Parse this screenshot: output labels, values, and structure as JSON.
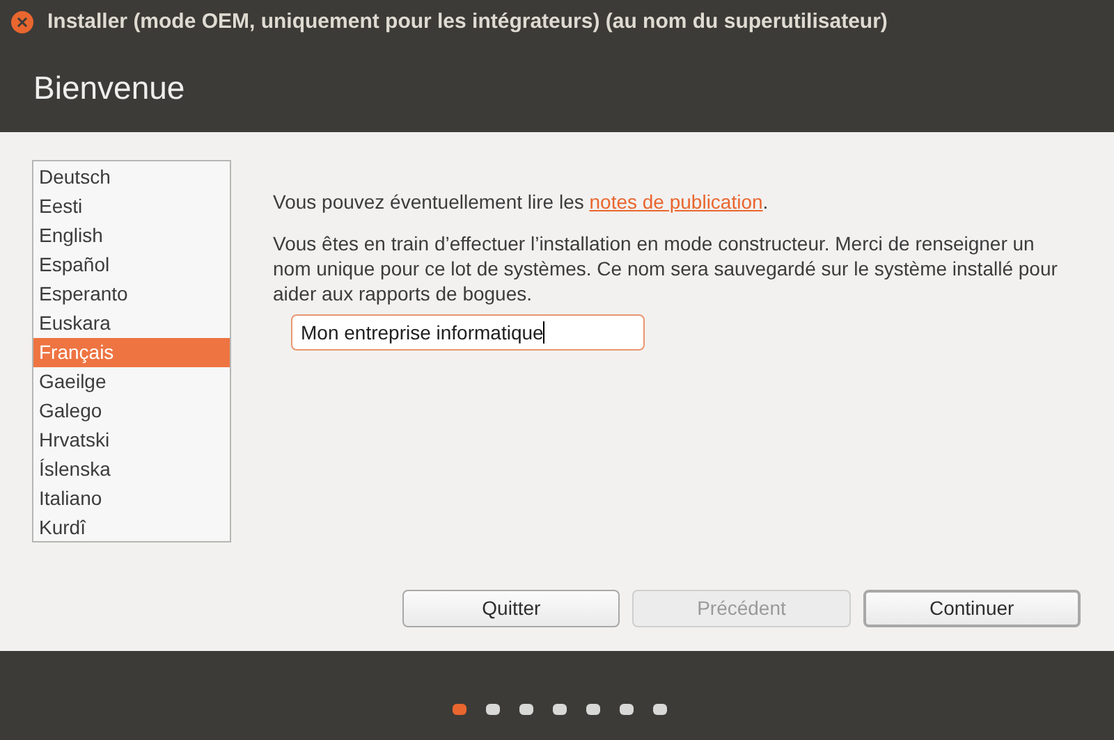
{
  "window": {
    "title": "Installer (mode OEM, uniquement pour les intégrateurs) (au nom du superutilisateur)"
  },
  "header": {
    "title": "Bienvenue"
  },
  "languages": [
    {
      "label": "Deutsch",
      "selected": false
    },
    {
      "label": "Eesti",
      "selected": false
    },
    {
      "label": "English",
      "selected": false
    },
    {
      "label": "Español",
      "selected": false
    },
    {
      "label": "Esperanto",
      "selected": false
    },
    {
      "label": "Euskara",
      "selected": false
    },
    {
      "label": "Français",
      "selected": true
    },
    {
      "label": "Gaeilge",
      "selected": false
    },
    {
      "label": "Galego",
      "selected": false
    },
    {
      "label": "Hrvatski",
      "selected": false
    },
    {
      "label": "Íslenska",
      "selected": false
    },
    {
      "label": "Italiano",
      "selected": false
    },
    {
      "label": "Kurdî",
      "selected": false
    }
  ],
  "release_notes": {
    "text_before": "Vous pouvez éventuellement lire les",
    "link": "notes de publication",
    "text_after": "."
  },
  "oem_message": "Vous êtes en train d’effectuer l’installation en mode constructeur. Merci de renseigner un nom unique pour ce lot de systèmes. Ce nom sera sauvegardé sur le système installé pour aider aux rapports de bogues.",
  "batch_name": {
    "value": "Mon entreprise informatique"
  },
  "buttons": [
    {
      "label": "Quitter",
      "disabled": false,
      "default": false
    },
    {
      "label": "Précédent",
      "disabled": true,
      "default": false
    },
    {
      "label": "Continuer",
      "disabled": false,
      "default": true
    }
  ],
  "steps": [
    {
      "selected": true
    },
    {
      "selected": false
    },
    {
      "selected": false
    },
    {
      "selected": false
    },
    {
      "selected": false
    },
    {
      "selected": false
    },
    {
      "selected": false
    }
  ]
}
